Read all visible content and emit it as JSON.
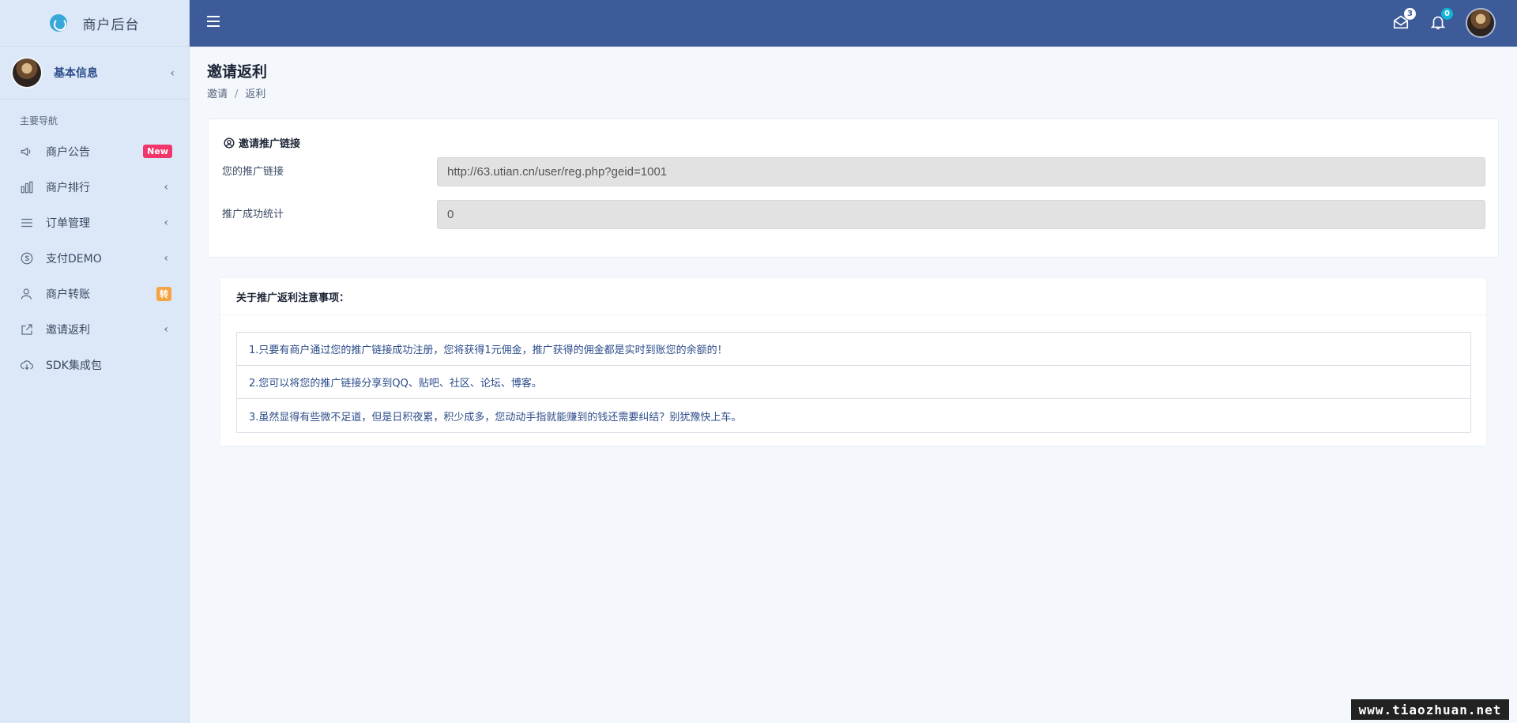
{
  "brand": {
    "title": "商户后台"
  },
  "user": {
    "name": "基本信息"
  },
  "sidebar": {
    "section_header": "主要导航",
    "items": [
      {
        "label": "商户公告",
        "badge": "New"
      },
      {
        "label": "商户排行"
      },
      {
        "label": "订单管理"
      },
      {
        "label": "支付DEMO"
      },
      {
        "label": "商户转账",
        "badge": "转"
      },
      {
        "label": "邀请返利"
      },
      {
        "label": "SDK集成包"
      }
    ]
  },
  "topbar": {
    "mail_count": "3",
    "notify_count": "0"
  },
  "page": {
    "title": "邀请返利",
    "breadcrumb": [
      "邀请",
      "返利"
    ]
  },
  "invite_card": {
    "title": "邀请推广链接",
    "link_label": "您的推广链接",
    "link_value": "http://63.utian.cn/user/reg.php?geid=1001",
    "stats_label": "推广成功统计",
    "stats_value": "0"
  },
  "notes_card": {
    "title": "关于推广返利注意事项：",
    "items": [
      "1.只要有商户通过您的推广链接成功注册，您将获得1元佣金，推广获得的佣金都是实时到账您的余额的！",
      "2.您可以将您的推广链接分享到QQ、贴吧、社区、论坛、博客。",
      "3.虽然显得有些微不足道，但是日积夜累，积少成多，您动动手指就能赚到的钱还需要纠结？别犹豫快上车。"
    ]
  },
  "watermark": "www.tiaozhuan.net"
}
